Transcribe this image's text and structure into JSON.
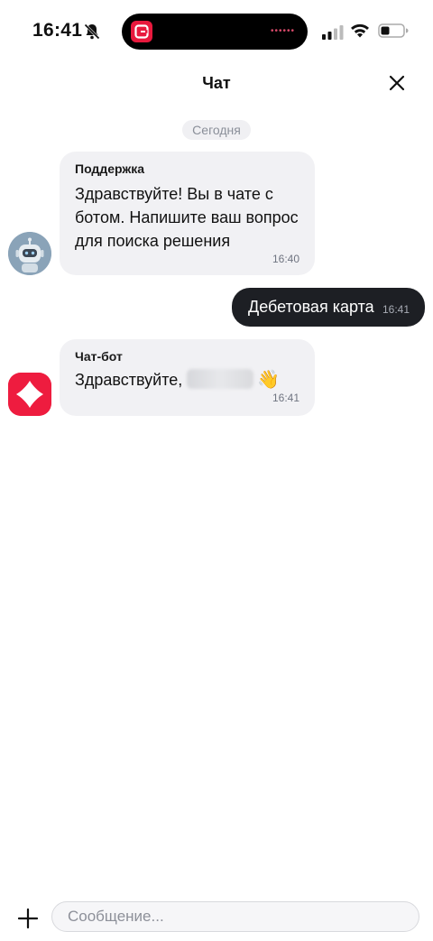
{
  "status_bar": {
    "time": "16:41",
    "icons": [
      "bell-slash-icon",
      "cellular-signal-icon",
      "wifi-icon",
      "battery-icon"
    ],
    "island_app_icon": "app-logo-icon"
  },
  "header": {
    "title": "Чат",
    "close_icon": "close-icon"
  },
  "date_divider": "Сегодня",
  "messages": [
    {
      "direction": "incoming",
      "sender": "Поддержка",
      "lines": [
        "Здравствуйте! Вы в чате с",
        "ботом. Напишите ваш вопрос",
        "для поиска решения"
      ],
      "time": "16:40",
      "avatar_icon": "robot-avatar-icon"
    },
    {
      "direction": "outgoing",
      "text": "Дебетовая карта",
      "time": "16:41"
    },
    {
      "direction": "incoming",
      "sender": "Чат-бот",
      "text": "Здравствуйте,",
      "emoji": "👋",
      "time": "16:41",
      "avatar_icon": "brand-avatar-icon"
    }
  ],
  "composer": {
    "placeholder": "Сообщение...",
    "value": "",
    "attach_icon": "plus-icon"
  },
  "colors": {
    "incoming_bubble": "#f1f1f4",
    "outgoing_bubble": "#1d1f24",
    "brand_red": "#ee1c3f",
    "muted_text": "#8a8f99"
  }
}
